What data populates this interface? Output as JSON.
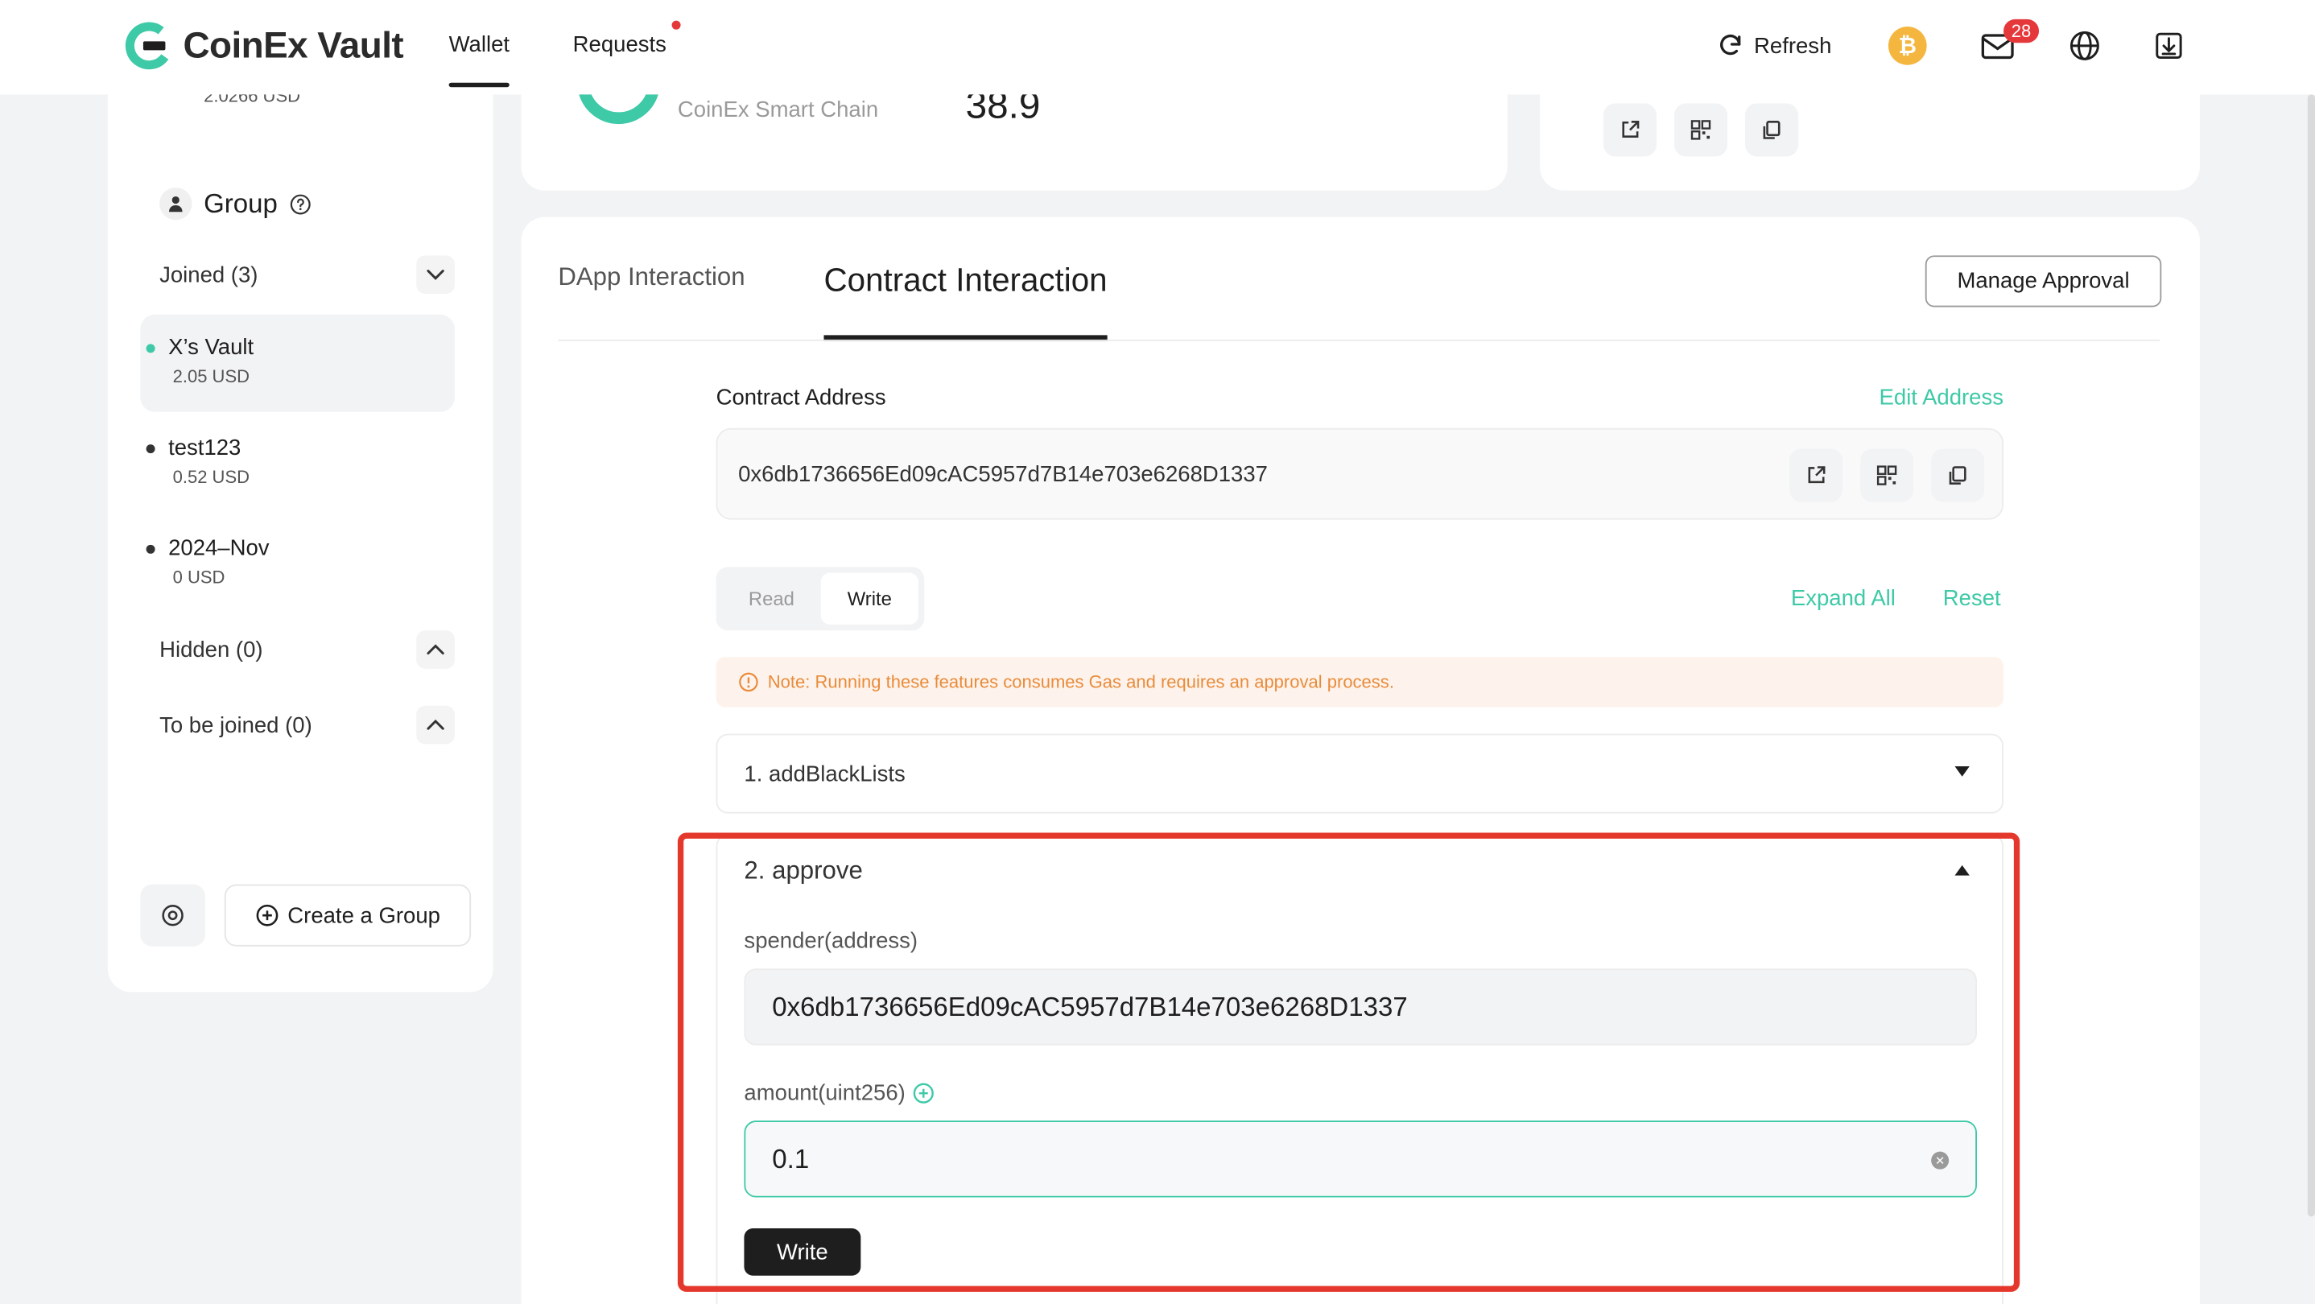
{
  "header": {
    "logo_text": "CoinEx Vault",
    "nav": {
      "wallet": "Wallet",
      "requests": "Requests"
    },
    "refresh_label": "Refresh",
    "coin_symbol": "₿",
    "mail_badge": "28"
  },
  "sidebar": {
    "top_usd": "2.0266  USD",
    "group_title": "Group",
    "joined_label": "Joined (3)",
    "vaults": [
      {
        "name": "X’s Vault",
        "usd": "2.05  USD"
      },
      {
        "name": "test123",
        "usd": "0.52  USD"
      },
      {
        "name": "2024–Nov",
        "usd": "0  USD"
      }
    ],
    "hidden_label": "Hidden (0)",
    "to_be_joined_label": "To be joined (0)",
    "create_group_label": "Create a Group"
  },
  "top_card": {
    "chain_name": "CoinEx Smart Chain",
    "balance": "38.9"
  },
  "main": {
    "tabs": {
      "dapp": "DApp Interaction",
      "contract": "Contract Interaction"
    },
    "manage_approval": "Manage Approval",
    "contract_address_label": "Contract Address",
    "edit_address": "Edit Address",
    "contract_address": "0x6db1736656Ed09cAC5957d7B14e703e6268D1337",
    "read_label": "Read",
    "write_label": "Write",
    "expand_all": "Expand All",
    "reset": "Reset",
    "note": "Note: Running these features consumes Gas and requires an approval process.",
    "functions": [
      {
        "title": "1. addBlackLists"
      },
      {
        "title": "2. approve"
      }
    ],
    "approve": {
      "spender_label": "spender(address)",
      "spender_value": "0x6db1736656Ed09cAC5957d7B14e703e6268D1337",
      "amount_label": "amount(uint256)",
      "amount_value": "0.1",
      "write_button": "Write"
    }
  },
  "colors": {
    "accent": "#3ec9a7",
    "highlight": "#e5382c",
    "badge": "#e5383b",
    "coin": "#f4b63f"
  }
}
